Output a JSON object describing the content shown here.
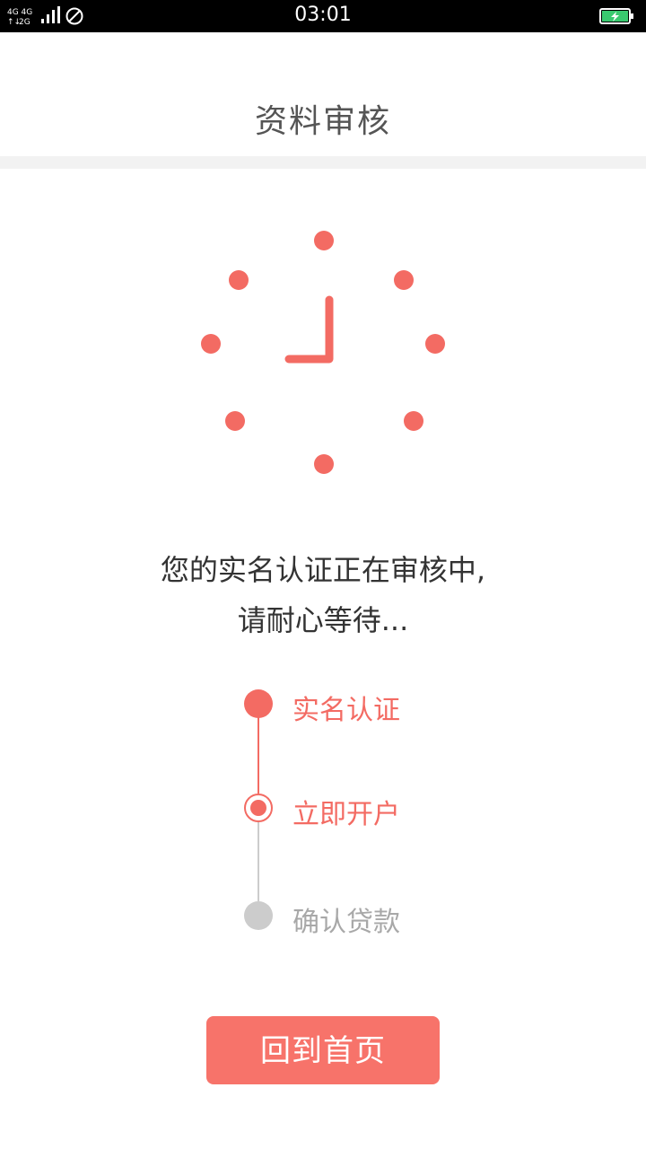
{
  "status_bar": {
    "network_top": "4G 4G",
    "network_bottom": "2G",
    "time": "03:01",
    "icons": [
      "signal-icon",
      "no-disturb-icon",
      "battery-charging-icon"
    ]
  },
  "header": {
    "title": "资料审核"
  },
  "illustration": {
    "icon": "clock-icon",
    "color": "#f36b63"
  },
  "message": {
    "line1": "您的实名认证正在审核中,",
    "line2": "请耐心等待..."
  },
  "steps": [
    {
      "label": "实名认证",
      "status": "completed"
    },
    {
      "label": "立即开户",
      "status": "current"
    },
    {
      "label": "确认贷款",
      "status": "pending"
    }
  ],
  "colors": {
    "accent": "#f36b63",
    "button": "#f7736a",
    "inactive": "#cccccc"
  },
  "actions": {
    "home_button": "回到首页"
  }
}
